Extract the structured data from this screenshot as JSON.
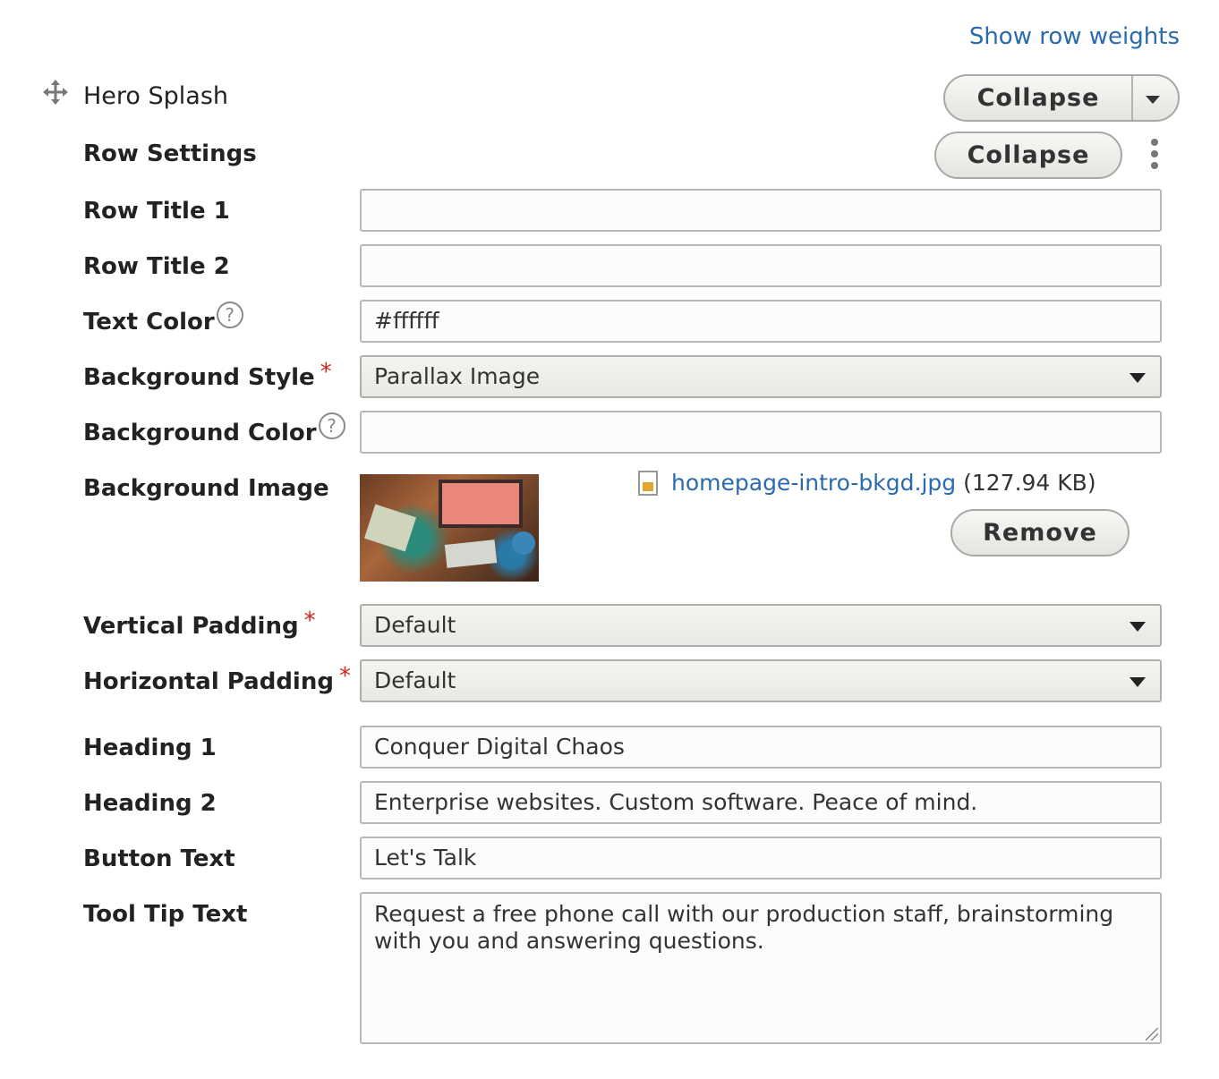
{
  "header": {
    "show_row_weights": "Show row weights"
  },
  "row": {
    "title": "Hero Splash",
    "collapse_label": "Collapse"
  },
  "row_settings": {
    "label": "Row Settings",
    "collapse_label": "Collapse"
  },
  "fields": {
    "row_title_1": {
      "label": "Row Title 1",
      "value": ""
    },
    "row_title_2": {
      "label": "Row Title 2",
      "value": ""
    },
    "text_color": {
      "label": "Text Color",
      "value": "#ffffff",
      "help": "?"
    },
    "background_style": {
      "label": "Background Style",
      "value": "Parallax Image",
      "required": "*"
    },
    "background_color": {
      "label": "Background Color",
      "value": "",
      "help": "?"
    },
    "background_image": {
      "label": "Background Image",
      "file_name": "homepage-intro-bkgd.jpg",
      "file_size": "(127.94 KB)",
      "remove_label": "Remove"
    },
    "vertical_padding": {
      "label": "Vertical Padding",
      "value": "Default",
      "required": "*"
    },
    "horizontal_padding": {
      "label": "Horizontal Padding",
      "value": "Default",
      "required": "*"
    },
    "heading_1": {
      "label": "Heading 1",
      "value": "Conquer Digital Chaos"
    },
    "heading_2": {
      "label": "Heading 2",
      "value": "Enterprise websites. Custom software. Peace of mind."
    },
    "button_text": {
      "label": "Button Text",
      "value": "Let's Talk"
    },
    "tool_tip_text": {
      "label": "Tool Tip Text",
      "value": "Request a free phone call with our production staff, brainstorming with you and answering questions."
    }
  },
  "icons": {
    "drag": "move-arrows-icon",
    "more": "vertical-dots-icon",
    "caret": "caret-down-icon",
    "file": "image-file-icon",
    "help": "question-circle-icon"
  },
  "colors": {
    "link": "#2a6aae",
    "required": "#d0271d"
  }
}
